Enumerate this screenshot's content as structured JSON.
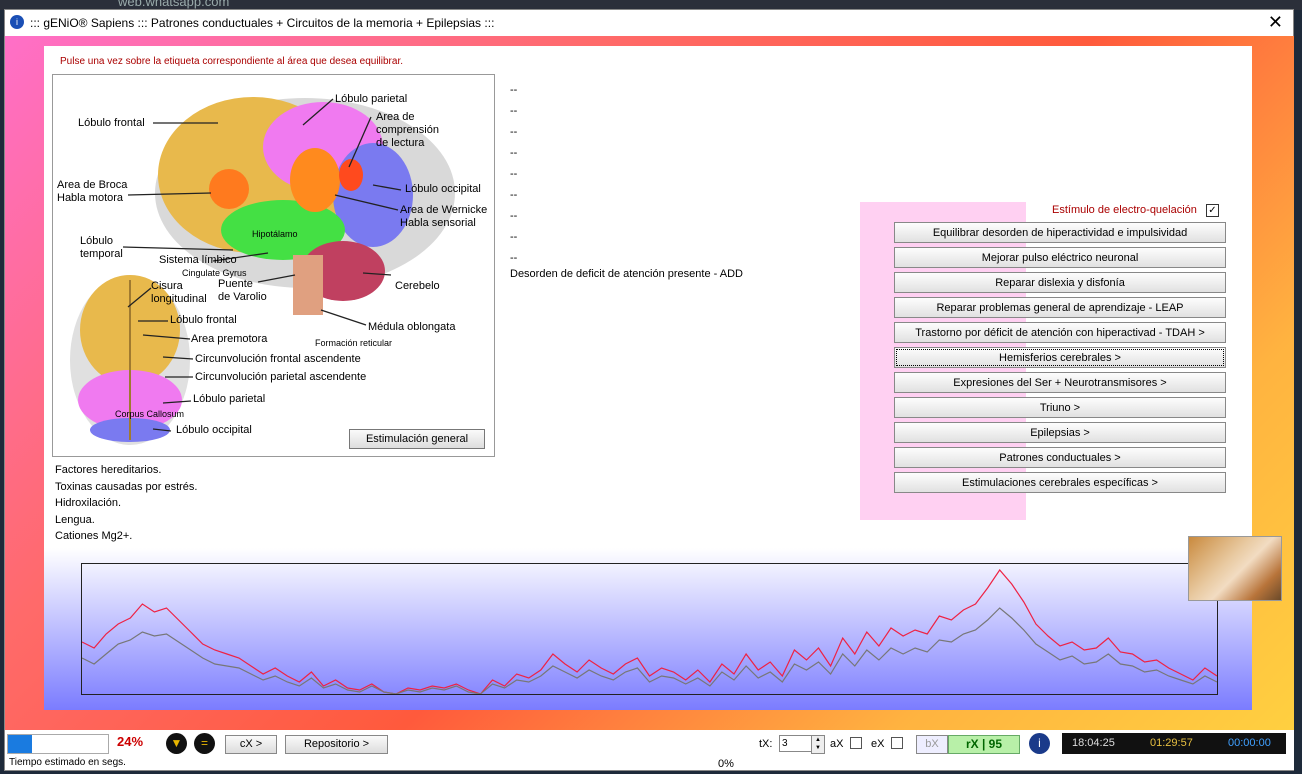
{
  "browser": {
    "url": "web.whatsapp.com"
  },
  "window": {
    "title": "::: gENiO® Sapiens ::: Patrones conductuales + Circuitos de la memoria + Epilepsias :::",
    "close": "✕"
  },
  "instruction": "Pulse una vez sobre la etiqueta correspondiente al área que desea equilibrar.",
  "brain": {
    "labels": {
      "frontal": "Lóbulo frontal",
      "parietal": "Lóbulo parietal",
      "comprension": "Area de\ncomprensión\nde lectura",
      "broca": "Area de Broca\nHabla motora",
      "occipital": "Lóbulo occipital",
      "wernicke": "Area de Wernicke\nHabla sensorial",
      "hipotalamo": "Hipotálamo",
      "temporal": "Lóbulo\ntemporal",
      "limbico": "Sistema límbico",
      "cingulate": "Cingulate Gyrus",
      "puente": "Puente\nde Varolio",
      "cerebelo": "Cerebelo",
      "cisura": "Cisura\nlongitudinal",
      "frontal2": "Lóbulo frontal",
      "premotora": "Area premotora",
      "medula": "Médula oblongata",
      "reticular": "Formación reticular",
      "circ_frontal": "Circunvolución frontal ascendente",
      "circ_parietal": "Circunvolución parietal ascendente",
      "parietal2": "Lóbulo parietal",
      "callosum": "Corpus Callosum",
      "occipital2": "Lóbulo occipital"
    },
    "button": "Estimulación general"
  },
  "factors": [
    "Factores hereditarios.",
    "Toxinas causadas por estrés.",
    "Hidroxilación.",
    "Lengua.",
    "Cationes Mg2+."
  ],
  "dashes": [
    "--",
    "--",
    "--",
    "--",
    "--",
    "--",
    "--",
    "--",
    "--"
  ],
  "add_text": "Desorden de deficit de atención presente - ADD",
  "electro": {
    "label": "Estímulo de electro-quelación",
    "checked": "✓"
  },
  "menu": [
    "Equilibrar desorden de hiperactividad e impulsividad",
    "Mejorar pulso eléctrico neuronal",
    "Reparar dislexia y disfonía",
    "Reparar problemas general de aprendizaje - LEAP",
    "Trastorno por déficit de atención con hiperactivad - TDAH >",
    "Hemisferios cerebrales >",
    "Expresiones del Ser + Neurotransmisores >",
    "Triuno >",
    "Epilepsias >",
    "Patrones conductuales >",
    "Estimulaciones cerebrales específicas >"
  ],
  "chart_data": {
    "type": "line",
    "series": [
      {
        "color": "#ee2244",
        "values": [
          52,
          46,
          60,
          70,
          76,
          90,
          82,
          86,
          74,
          62,
          50,
          44,
          40,
          36,
          28,
          20,
          26,
          18,
          12,
          22,
          8,
          14,
          6,
          4,
          10,
          2,
          0,
          6,
          4,
          8,
          6,
          10,
          4,
          0,
          14,
          8,
          20,
          16,
          24,
          40,
          30,
          22,
          34,
          26,
          20,
          30,
          36,
          18,
          26,
          22,
          14,
          24,
          12,
          30,
          20,
          40,
          24,
          32,
          18,
          44,
          34,
          46,
          28,
          56,
          40,
          62,
          48,
          66,
          58,
          64,
          60,
          78,
          74,
          84,
          90,
          106,
          124,
          110,
          92,
          70,
          58,
          48,
          52,
          44,
          46,
          56,
          42,
          40,
          32,
          34,
          26,
          20,
          14,
          26,
          18
        ]
      },
      {
        "color": "#777777",
        "values": [
          36,
          30,
          40,
          50,
          54,
          62,
          58,
          60,
          52,
          44,
          36,
          30,
          28,
          26,
          20,
          14,
          18,
          12,
          8,
          16,
          6,
          10,
          4,
          2,
          8,
          2,
          0,
          4,
          2,
          6,
          4,
          8,
          2,
          0,
          10,
          6,
          14,
          12,
          18,
          28,
          22,
          16,
          24,
          18,
          14,
          22,
          26,
          12,
          18,
          16,
          10,
          16,
          8,
          22,
          14,
          28,
          16,
          22,
          12,
          30,
          24,
          32,
          20,
          40,
          28,
          44,
          34,
          46,
          40,
          46,
          42,
          54,
          52,
          60,
          64,
          74,
          86,
          76,
          64,
          50,
          42,
          34,
          38,
          30,
          32,
          40,
          30,
          28,
          22,
          24,
          18,
          14,
          10,
          18,
          12
        ]
      }
    ],
    "ylim": [
      0,
      130
    ]
  },
  "bottom": {
    "progress_pct": "24%",
    "progress_value": 24,
    "icon1": "▼",
    "icon2": "=",
    "cx_btn": "cX >",
    "repo_btn": "Repositorio >",
    "time_label": "Tiempo estimado en segs.",
    "zero_pct": "0%",
    "tx_label": "tX:",
    "tx_value": "3",
    "spin_up": "▲",
    "spin_down": "▼",
    "ax_label": "aX",
    "ex_label": "eX",
    "bx_label": "bX",
    "rx_label": "rX | 95",
    "info_icon": "i",
    "clock1": "18:04:25",
    "clock2": "01:29:57",
    "clock3": "00:00:00"
  },
  "colors": {
    "gradient_start": "#ff6fc8",
    "gradient_end": "#ffd040",
    "panel_pink": "#ffd0f2",
    "red_text": "#a00000"
  }
}
